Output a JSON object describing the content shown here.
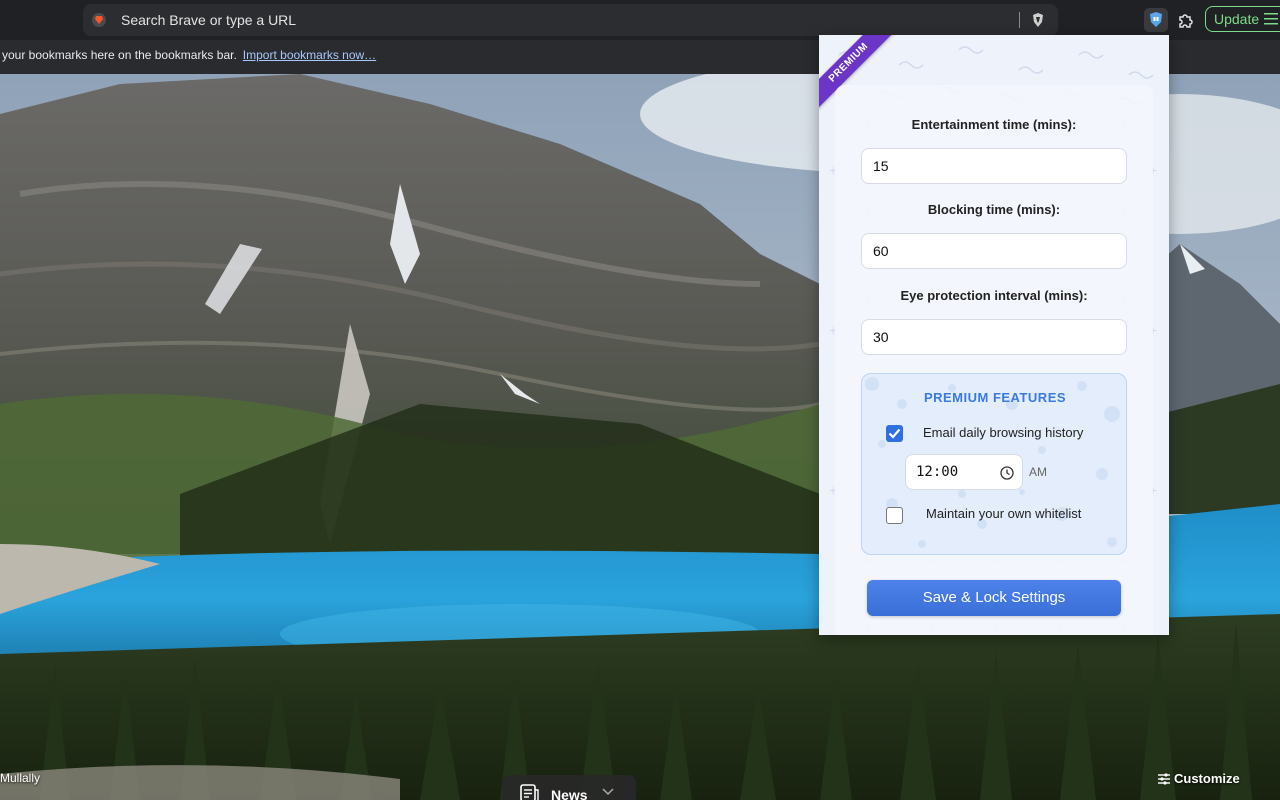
{
  "browser": {
    "omnibox_placeholder": "Search Brave or type a URL",
    "update_label": "Update",
    "bookmarks_message": "your bookmarks here on the bookmarks bar.",
    "import_link": "Import bookmarks now…"
  },
  "new_tab": {
    "photo_credit": "Mullally",
    "news_label": "News",
    "customize_label": "Customize"
  },
  "popup": {
    "ribbon": "PREMIUM",
    "entertainment": {
      "label": "Entertainment time (mins):",
      "value": "15"
    },
    "blocking": {
      "label": "Blocking time (mins):",
      "value": "60"
    },
    "eye": {
      "label": "Eye protection interval (mins):",
      "value": "30"
    },
    "premium": {
      "title": "PREMIUM FEATURES",
      "email_history": {
        "label": "Email daily browsing history",
        "checked": true
      },
      "time": {
        "value": "12:00",
        "period": "AM"
      },
      "whitelist": {
        "label": "Maintain your own whitelist",
        "checked": false
      }
    },
    "save_label": "Save & Lock Settings"
  },
  "colors": {
    "accent": "#3a6fd8",
    "ribbon": "#6b35c7",
    "update_green": "#7ddc8a"
  }
}
